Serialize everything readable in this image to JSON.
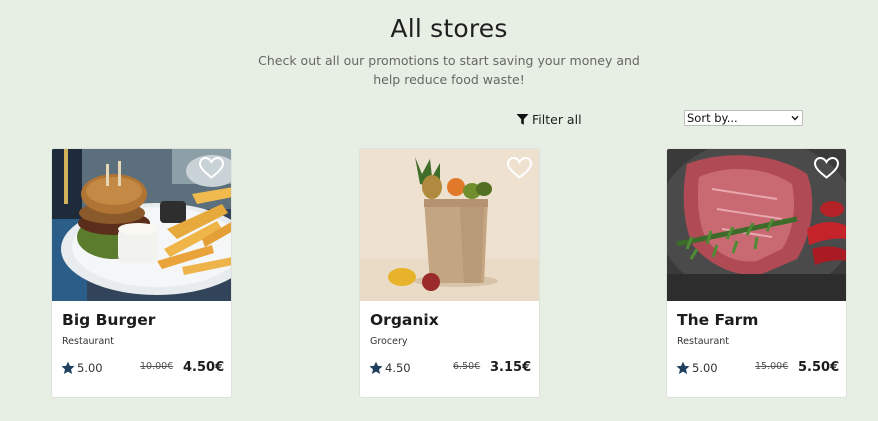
{
  "header": {
    "title": "All stores",
    "subtitle": "Check out all our promotions to start saving your money and help reduce food waste!"
  },
  "toolbar": {
    "filter_label": "Filter all",
    "sort_label": "Sort by..."
  },
  "colors": {
    "background": "#e7efe4",
    "star": "#1f3f5e"
  },
  "stores": [
    {
      "name": "Big Burger",
      "category": "Restaurant",
      "rating": "5.00",
      "old_price": "10.00€",
      "new_price": "4.50€",
      "image": "burger-and-fries-photo"
    },
    {
      "name": "Organix",
      "category": "Grocery",
      "rating": "4.50",
      "old_price": "6.50€",
      "new_price": "3.15€",
      "image": "grocery-bag-photo"
    },
    {
      "name": "The Farm",
      "category": "Restaurant",
      "rating": "5.00",
      "old_price": "15.00€",
      "new_price": "5.50€",
      "image": "raw-steak-photo"
    }
  ]
}
